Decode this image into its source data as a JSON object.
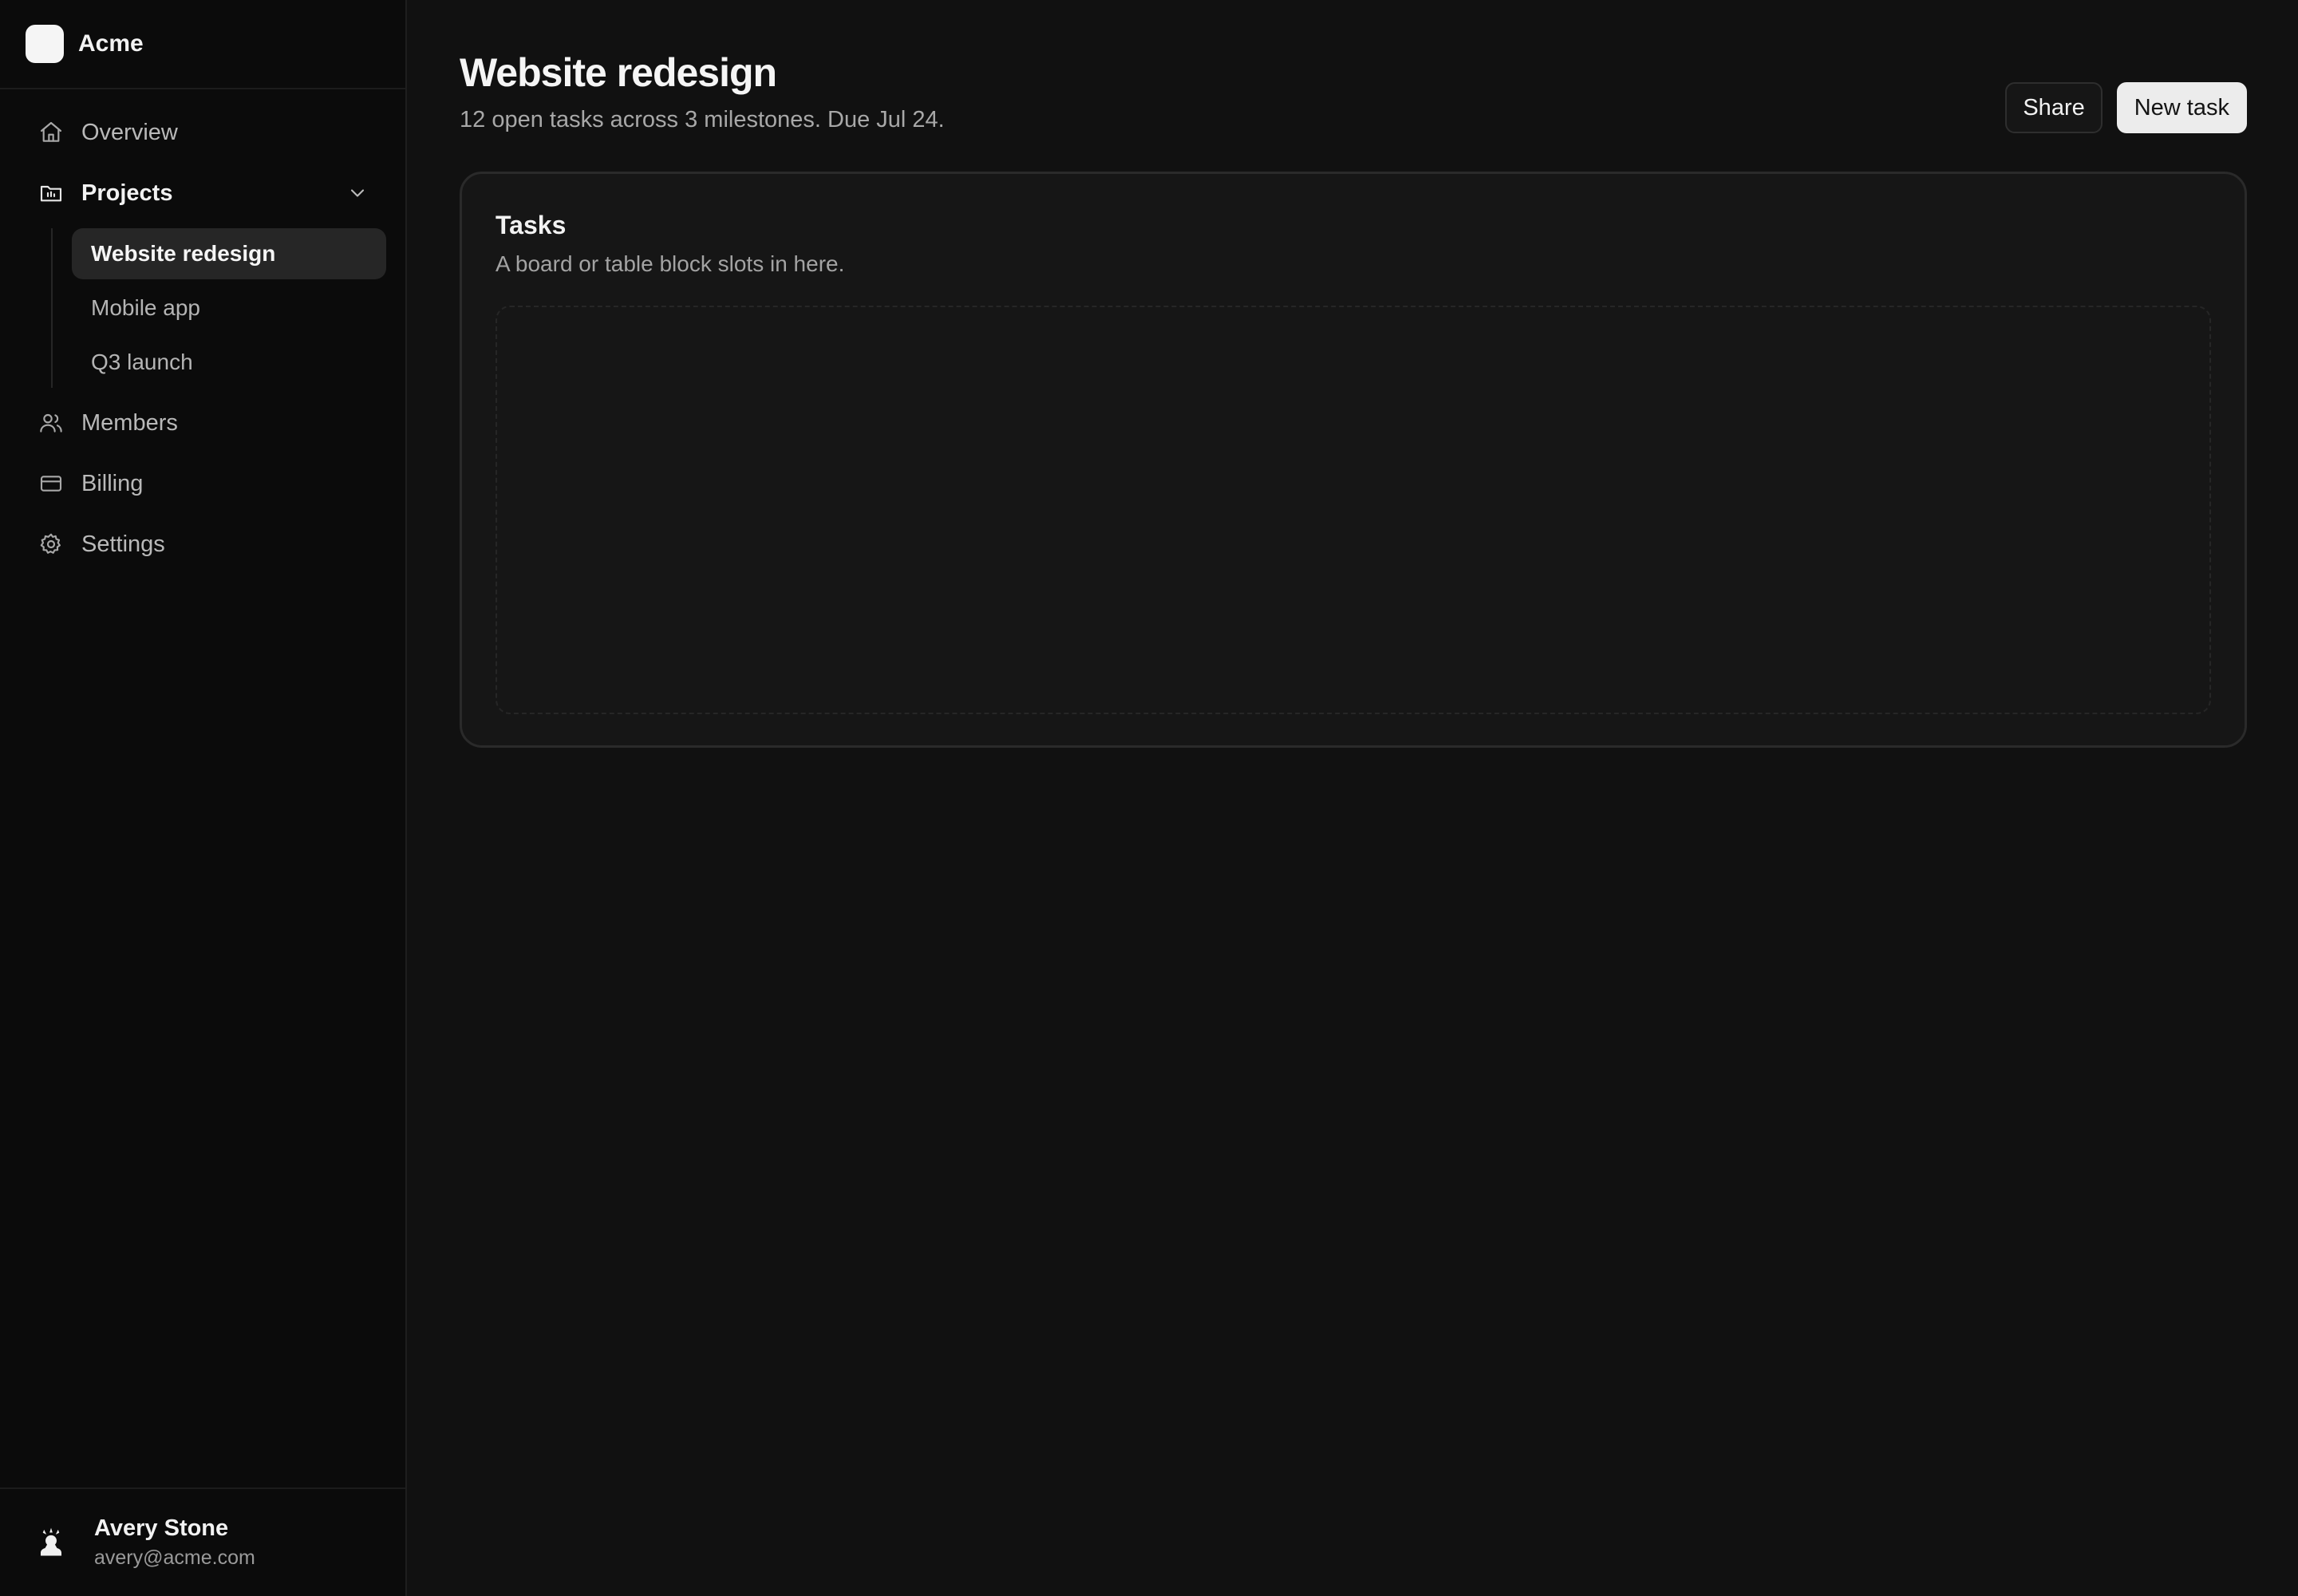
{
  "brand": {
    "name": "Acme"
  },
  "sidebar": {
    "items": [
      {
        "label": "Overview",
        "icon": "home-icon"
      },
      {
        "label": "Projects",
        "icon": "folder-icon",
        "expanded": true,
        "children": [
          {
            "label": "Website redesign",
            "active": true
          },
          {
            "label": "Mobile app"
          },
          {
            "label": "Q3 launch"
          }
        ]
      },
      {
        "label": "Members",
        "icon": "users-icon"
      },
      {
        "label": "Billing",
        "icon": "credit-card-icon"
      },
      {
        "label": "Settings",
        "icon": "gear-icon"
      }
    ]
  },
  "user": {
    "name": "Avery Stone",
    "email": "avery@acme.com"
  },
  "header": {
    "title": "Website redesign",
    "subtitle": "12 open tasks across 3 milestones. Due Jul 24.",
    "share_label": "Share",
    "new_task_label": "New task"
  },
  "card": {
    "title": "Tasks",
    "description": "A board or table block slots in here."
  },
  "colors": {
    "background": "#111111",
    "sidebar": "#0b0b0b",
    "active_item": "#262626",
    "primary_button": "#ececec"
  }
}
